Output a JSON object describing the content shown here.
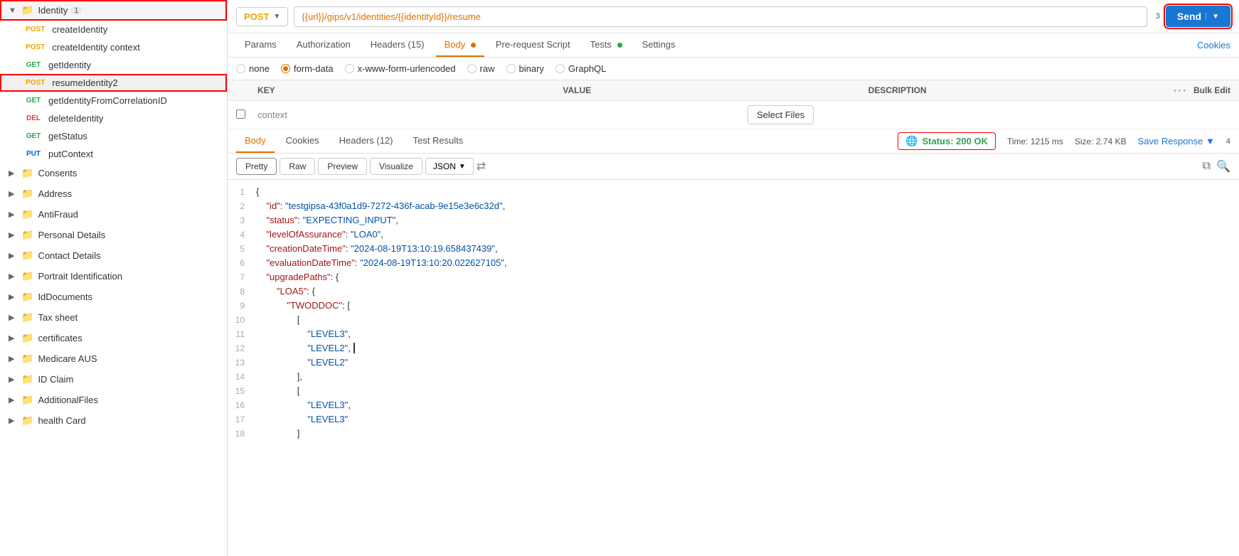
{
  "sidebar": {
    "title": "Identity",
    "badge_num": "1",
    "items": [
      {
        "id": "identity",
        "label": "Identity",
        "type": "folder",
        "expanded": true,
        "highlighted": true,
        "badge": "1",
        "sub_items": [
          {
            "id": "createIdentity",
            "method": "POST",
            "label": "createIdentity"
          },
          {
            "id": "createIdentityContext",
            "method": "POST",
            "label": "createIdentity context"
          },
          {
            "id": "getIdentity",
            "method": "GET",
            "label": "getIdentity"
          },
          {
            "id": "resumeIdentity",
            "method": "POST",
            "label": "resumeIdentity",
            "highlighted": true,
            "badge": "2"
          },
          {
            "id": "getIdentityFromCorrelationID",
            "method": "GET",
            "label": "getIdentityFromCorrelationID"
          },
          {
            "id": "deleteIdentity",
            "method": "DEL",
            "label": "deleteIdentity"
          },
          {
            "id": "getStatus",
            "method": "GET",
            "label": "getStatus"
          },
          {
            "id": "putContext",
            "method": "PUT",
            "label": "putContext"
          }
        ]
      },
      {
        "id": "consents",
        "label": "Consents",
        "type": "folder"
      },
      {
        "id": "address",
        "label": "Address",
        "type": "folder"
      },
      {
        "id": "antifraud",
        "label": "AntiFraud",
        "type": "folder"
      },
      {
        "id": "personal-details",
        "label": "Personal Details",
        "type": "folder"
      },
      {
        "id": "contact-details",
        "label": "Contact Details",
        "type": "folder"
      },
      {
        "id": "portrait-identification",
        "label": "Portrait Identification",
        "type": "folder"
      },
      {
        "id": "id-documents",
        "label": "IdDocuments",
        "type": "folder"
      },
      {
        "id": "tax-sheet",
        "label": "Tax sheet",
        "type": "folder"
      },
      {
        "id": "certificates",
        "label": "certificates",
        "type": "folder"
      },
      {
        "id": "medicare-aus",
        "label": "Medicare AUS",
        "type": "folder"
      },
      {
        "id": "id-claim",
        "label": "ID Claim",
        "type": "folder"
      },
      {
        "id": "additional-files",
        "label": "AdditionalFiles",
        "type": "folder"
      },
      {
        "id": "health-card",
        "label": "health Card",
        "type": "folder"
      }
    ]
  },
  "request": {
    "method": "POST",
    "url": "{{url}}/gips/v1/identities/{{identityId}}/resume",
    "send_label": "Send",
    "tabs": [
      {
        "id": "params",
        "label": "Params"
      },
      {
        "id": "authorization",
        "label": "Authorization"
      },
      {
        "id": "headers",
        "label": "Headers (15)"
      },
      {
        "id": "body",
        "label": "Body",
        "active": true,
        "dot": "orange"
      },
      {
        "id": "pre-request",
        "label": "Pre-request Script"
      },
      {
        "id": "tests",
        "label": "Tests",
        "dot": "green"
      },
      {
        "id": "settings",
        "label": "Settings"
      }
    ],
    "cookies_label": "Cookies",
    "body_options": [
      {
        "id": "none",
        "label": "none"
      },
      {
        "id": "form-data",
        "label": "form-data",
        "selected": true
      },
      {
        "id": "x-www-form-urlencoded",
        "label": "x-www-form-urlencoded"
      },
      {
        "id": "raw",
        "label": "raw"
      },
      {
        "id": "binary",
        "label": "binary"
      },
      {
        "id": "graphql",
        "label": "GraphQL"
      }
    ],
    "kv_headers": {
      "key": "KEY",
      "value": "VALUE",
      "description": "DESCRIPTION",
      "bulk_edit": "Bulk Edit"
    },
    "kv_rows": [
      {
        "key": "context",
        "value": "",
        "has_file_select": true
      }
    ],
    "select_files_label": "Select Files"
  },
  "response": {
    "tabs": [
      {
        "id": "body",
        "label": "Body",
        "active": true
      },
      {
        "id": "cookies",
        "label": "Cookies"
      },
      {
        "id": "headers",
        "label": "Headers (12)"
      },
      {
        "id": "test-results",
        "label": "Test Results"
      }
    ],
    "status": "Status: 200 OK",
    "time": "Time: 1215 ms",
    "size": "Size: 2.74 KB",
    "save_response": "Save Response",
    "json_toolbar": {
      "pretty": "Pretty",
      "raw": "Raw",
      "preview": "Preview",
      "visualize": "Visualize",
      "format": "JSON"
    },
    "json_lines": [
      {
        "num": 1,
        "content": "{",
        "type": "punctuation"
      },
      {
        "num": 2,
        "content": "    \"id\": \"testgipsa-43f0a1d9-7272-436f-acab-9e15e3e6c32d\",",
        "type": "kv"
      },
      {
        "num": 3,
        "content": "    \"status\": \"EXPECTING_INPUT\",",
        "type": "kv"
      },
      {
        "num": 4,
        "content": "    \"levelOfAssurance\": \"LOA0\",",
        "type": "kv"
      },
      {
        "num": 5,
        "content": "    \"creationDateTime\": \"2024-08-19T13:10:19.658437439\",",
        "type": "kv"
      },
      {
        "num": 6,
        "content": "    \"evaluationDateTime\": \"2024-08-19T13:10:20.022627105\",",
        "type": "kv"
      },
      {
        "num": 7,
        "content": "    \"upgradePaths\": {",
        "type": "kv_obj"
      },
      {
        "num": 8,
        "content": "        \"LOA5\": {",
        "type": "kv_obj"
      },
      {
        "num": 9,
        "content": "            \"TWODDOC\": [",
        "type": "kv_arr"
      },
      {
        "num": 10,
        "content": "                [",
        "type": "bracket"
      },
      {
        "num": 11,
        "content": "                    \"LEVEL3\",",
        "type": "string_val"
      },
      {
        "num": 12,
        "content": "                    \"LEVEL2\",",
        "type": "string_val"
      },
      {
        "num": 13,
        "content": "                    \"LEVEL2\"",
        "type": "string_val"
      },
      {
        "num": 14,
        "content": "                ],",
        "type": "bracket"
      },
      {
        "num": 15,
        "content": "                [",
        "type": "bracket"
      },
      {
        "num": 16,
        "content": "                    \"LEVEL3\",",
        "type": "string_val"
      },
      {
        "num": 17,
        "content": "                    \"LEVEL3\"",
        "type": "string_val"
      },
      {
        "num": 18,
        "content": "                ]",
        "type": "bracket"
      }
    ]
  },
  "annotations": {
    "badge_1": "1",
    "badge_2": "2",
    "badge_3": "3",
    "badge_4": "4"
  }
}
